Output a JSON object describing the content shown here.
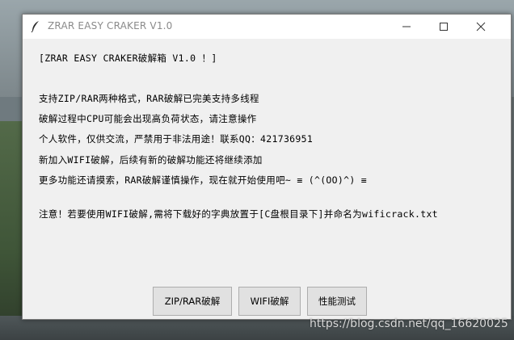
{
  "window": {
    "title": "ZRAR EASY CRAKER V1.0",
    "controls": {
      "minimize": "minimize-icon",
      "maximize": "maximize-icon",
      "close": "close-icon"
    }
  },
  "content": {
    "header": "[ZRAR EASY CRAKER破解箱 V1.0 ！]",
    "lines": [
      "支持ZIP/RAR两种格式，RAR破解已完美支持多线程",
      "破解过程中CPU可能会出现高负荷状态，请注意操作",
      "个人软件，仅供交流，严禁用于非法用途！联系QQ：421736951",
      "新加入WIFI破解，后续有新的破解功能还将继续添加",
      "更多功能还请摸索，RAR破解谨慎操作，现在就开始使用吧~ ≡ (^(OO)^) ≡"
    ],
    "notice": "注意！若要使用WIFI破解,需将下载好的字典放置于[C盘根目录下]并命名为wificrack.txt"
  },
  "buttons": {
    "zip_rar": "ZIP/RAR破解",
    "wifi": "WIFI破解",
    "perf": "性能测试"
  },
  "watermark": "https://blog.csdn.net/qq_16620025"
}
